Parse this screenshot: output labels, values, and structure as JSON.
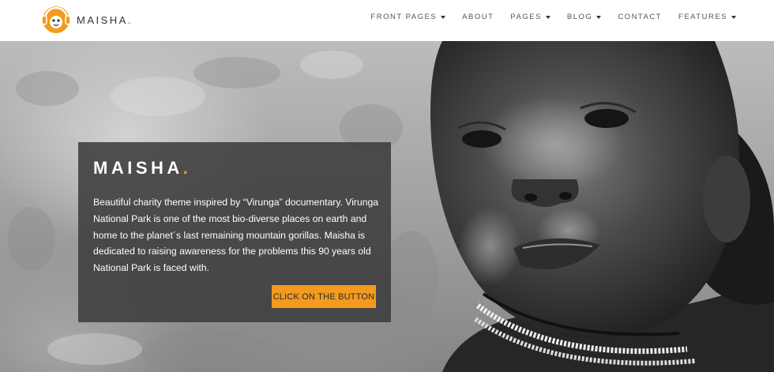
{
  "brand": {
    "name": "MAISHA",
    "dot": ".",
    "accent_color": "#f39c1f",
    "logo_icon": "monkey-with-headphones-icon"
  },
  "nav": {
    "items": [
      {
        "label": "FRONT PAGES",
        "has_dropdown": true
      },
      {
        "label": "ABOUT",
        "has_dropdown": false
      },
      {
        "label": "PAGES",
        "has_dropdown": true
      },
      {
        "label": "BLOG",
        "has_dropdown": true
      },
      {
        "label": "CONTACT",
        "has_dropdown": false
      },
      {
        "label": "FEATURES",
        "has_dropdown": true
      }
    ]
  },
  "hero": {
    "title": "MAISHA",
    "title_dot": ".",
    "text": "Beautiful charity theme inspired by “Virunga” documentary. Virunga National Park is one of the most bio-diverse places on earth and home to the planet´s last remaining mountain gorillas. Maisha is dedicated to raising awareness for the problems this 90 years old National Park is faced with.",
    "button_label": "CLICK ON THE BUTTON",
    "button_color": "#f39a1f",
    "box_color": "#3a3a3a"
  }
}
